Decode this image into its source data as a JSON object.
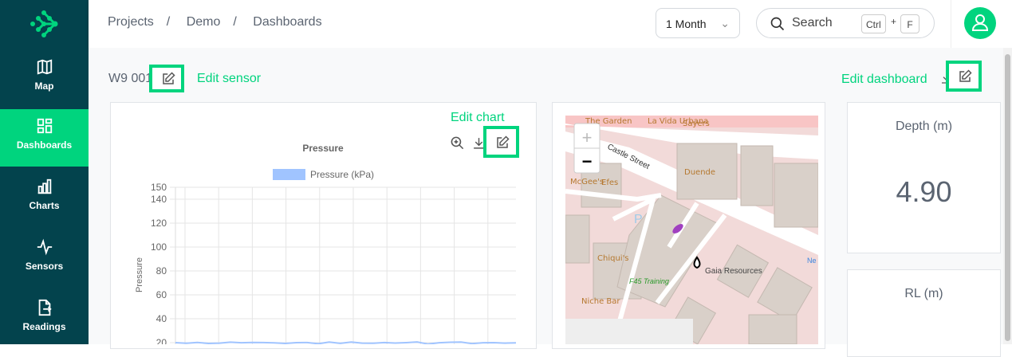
{
  "sidebar": {
    "items": [
      {
        "label": "Map"
      },
      {
        "label": "Dashboards"
      },
      {
        "label": "Charts"
      },
      {
        "label": "Sensors"
      },
      {
        "label": "Readings"
      }
    ]
  },
  "breadcrumb": [
    "Projects",
    "Demo",
    "Dashboards"
  ],
  "period": "1 Month",
  "search": {
    "placeholder": "Search",
    "keys": [
      "Ctrl",
      "F"
    ],
    "plus": "+"
  },
  "sensor": {
    "title": "W9 001",
    "edit_sensor": "Edit sensor",
    "edit_dashboard": "Edit dashboard",
    "edit_chart": "Edit chart"
  },
  "map": {
    "labels": [
      "The Garden",
      "La Vida Urbana",
      "Sayers",
      "Castle Street",
      "Duende",
      "McGee's",
      "Efes",
      "Chiqui's",
      "F45 Training",
      "Gaia Resources",
      "Niche Bar",
      "P",
      "Ne S aft"
    ],
    "zoom_in": "+",
    "zoom_out": "−"
  },
  "cards": [
    {
      "title": "Depth (m)",
      "value": "4.90"
    },
    {
      "title": "RL (m)",
      "value": ""
    }
  ],
  "chart_data": {
    "type": "line",
    "title": "Pressure",
    "ylabel": "Pressure",
    "xlabel": "",
    "ylim": [
      20,
      150
    ],
    "yticks": [
      150,
      140,
      120,
      100,
      80,
      60,
      40,
      20
    ],
    "legend": [
      {
        "label": "Pressure (kPa)",
        "color": "#a0c4ff"
      }
    ],
    "series": [
      {
        "name": "Pressure (kPa)",
        "values": [
          20,
          19.5,
          20.2,
          19.3,
          19.6,
          20.4,
          19.9,
          20.2,
          20.1,
          19.8,
          19.3,
          20,
          20.1,
          19.1,
          20.5,
          19.4,
          20.5,
          19.6,
          19.5,
          20.1,
          19.7,
          20,
          20.6,
          18.8,
          19.9,
          20.3,
          20.5,
          19.2,
          19.9,
          20,
          19.6,
          19.8
        ]
      }
    ]
  }
}
